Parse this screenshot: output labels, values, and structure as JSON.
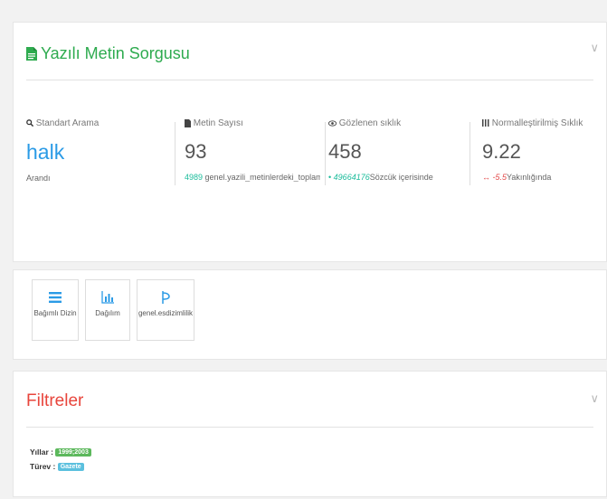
{
  "colors": {
    "accent_green": "#2eab4f",
    "primary_blue": "#2b9be6",
    "teal": "#1bbc9b",
    "filters_red": "#e8453c",
    "badge_green": "#5cb85c",
    "badge_blue": "#5bc0de",
    "negative_red": "#e34b4b"
  },
  "query_panel": {
    "title": "Yazılı Metin Sorgusu",
    "title_icon": "document-icon",
    "collapse_icon": "chevron-down-icon"
  },
  "stats": [
    {
      "icon": "search-icon",
      "label": "Standart Arama",
      "value": "halk",
      "note": "Arandı"
    },
    {
      "icon": "file-icon",
      "label": "Metin Sayısı",
      "value": "93",
      "note_number": "4989",
      "note_text": "genel.yazili_metinlerdeki_toplam_s"
    },
    {
      "icon": "eye-icon",
      "label": "Gözlenen sıklık",
      "value": "458",
      "note_number": "49664176",
      "note_text": "Sözcük içerisinde"
    },
    {
      "icon": "bar-chart-icon",
      "label": "Normalleştirilmiş Sıklık",
      "value": "9.22",
      "note_number": "-5.5",
      "note_text": "Yakınlığında"
    }
  ],
  "toolbar": {
    "buttons": [
      {
        "icon": "list-icon",
        "label": "Bağımlı Dizin"
      },
      {
        "icon": "chart-icon",
        "label": "Dağılım"
      },
      {
        "icon": "collocation-icon",
        "label": "genel.esdizimlilik"
      }
    ]
  },
  "filters_panel": {
    "title": "Filtreler",
    "collapse_icon": "chevron-down-icon",
    "years_label": "Yıllar :",
    "years_value": "1999;2003",
    "type_label": "Türev :",
    "type_value": "Gazete"
  }
}
